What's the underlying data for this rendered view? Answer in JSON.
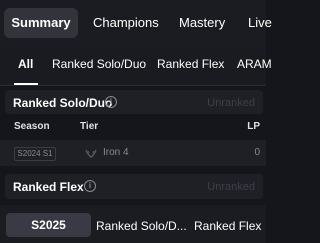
{
  "top_tabs": [
    {
      "label": "Summary",
      "active": true
    },
    {
      "label": "Champions"
    },
    {
      "label": "Mastery"
    },
    {
      "label": "Live"
    }
  ],
  "queue_tabs": [
    {
      "label": "All",
      "active": true
    },
    {
      "label": "Ranked Solo/Duo"
    },
    {
      "label": "Ranked Flex"
    },
    {
      "label": "ARAM"
    }
  ],
  "ranked_solo": {
    "title": "Ranked Solo/Duo",
    "info_icon": "info-icon",
    "status": "Unranked",
    "columns": {
      "season": "Season",
      "tier": "Tier",
      "lp": "LP"
    },
    "rows": [
      {
        "season": "S2024 S1",
        "tier_icon": "laurel-icon",
        "tier": "Iron 4",
        "lp": "0"
      }
    ]
  },
  "ranked_flex": {
    "title": "Ranked Flex",
    "info_icon": "info-icon",
    "status": "Unranked"
  },
  "bottom_tabs": [
    {
      "label": "S2025",
      "active": true
    },
    {
      "label": "Ranked Solo/D..."
    },
    {
      "label": "Ranked Flex"
    }
  ],
  "colors": {
    "background": "#15151c",
    "card": "#1f1f26",
    "active_tab": "#33333b",
    "muted_text": "#8a8a94",
    "unranked_text": "#3f3f48"
  }
}
